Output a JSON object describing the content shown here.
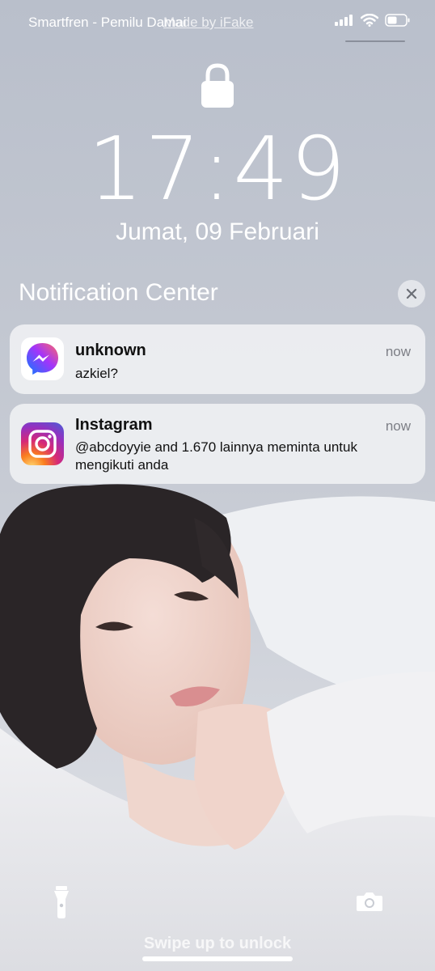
{
  "status_bar": {
    "carrier": "Smartfren - Pemilu Damai",
    "watermark": "Made by iFake",
    "icons": [
      "signal-icon",
      "wifi-icon",
      "battery-icon"
    ]
  },
  "lock_screen": {
    "time": "17:49",
    "date": "Jumat, 09 Februari"
  },
  "notification_center": {
    "title": "Notification Center",
    "notifications": [
      {
        "app": "unknown",
        "time": "now",
        "body": "azkiel?",
        "icon": "messenger-icon"
      },
      {
        "app": "Instagram",
        "time": "now",
        "body": "@abcdoyyie and 1.670 lainnya meminta untuk mengikuti anda",
        "icon": "instagram-icon"
      }
    ]
  },
  "bottom": {
    "swipe_hint": "Swipe up to unlock",
    "left_icon": "flashlight-icon",
    "right_icon": "camera-icon"
  },
  "colors": {
    "messenger_gradient": [
      "#3b6df7",
      "#a334fa",
      "#ff5f6d"
    ],
    "instagram_gradient": [
      "#feda75",
      "#fa7e1e",
      "#d62976",
      "#962fbf",
      "#4f5bd5"
    ]
  }
}
